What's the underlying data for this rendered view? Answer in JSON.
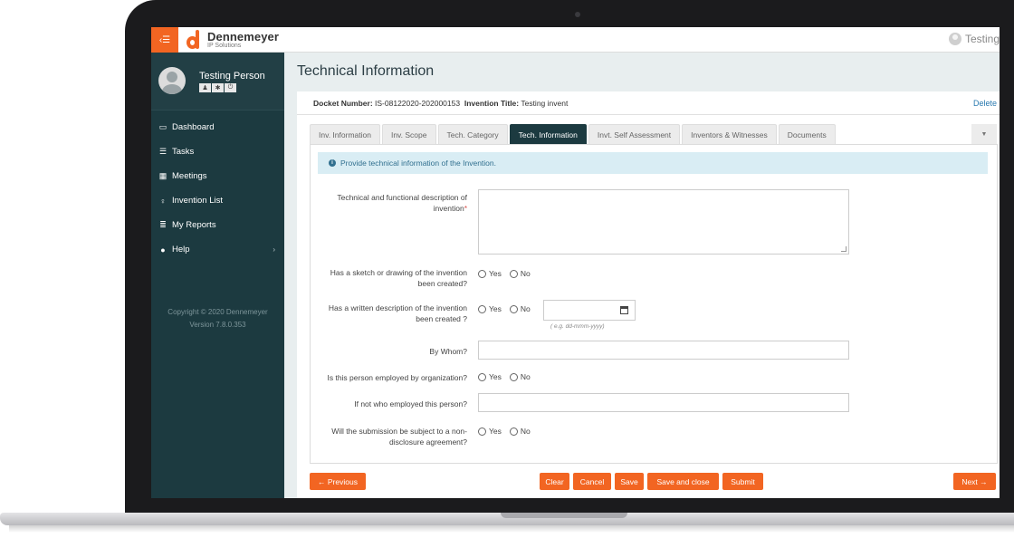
{
  "header": {
    "brand_name": "Dennemeyer",
    "brand_sub": "IP Solutions",
    "user_label": "Testing"
  },
  "sidebar": {
    "profile_name": "Testing Person",
    "items": [
      {
        "label": "Dashboard",
        "icon": "monitor-icon"
      },
      {
        "label": "Tasks",
        "icon": "list-icon"
      },
      {
        "label": "Meetings",
        "icon": "calendar-icon"
      },
      {
        "label": "Invention List",
        "icon": "lightbulb-icon"
      },
      {
        "label": "My Reports",
        "icon": "report-icon"
      },
      {
        "label": "Help",
        "icon": "question-icon"
      }
    ],
    "copyright": "Copyright © 2020 Dennemeyer",
    "version": "Version 7.8.0.353"
  },
  "page": {
    "title": "Technical Information",
    "docket_label": "Docket Number:",
    "docket_value": "IS-08122020-202000153",
    "invention_title_label": "Invention Title:",
    "invention_title_value": "Testing invent",
    "delete_label": "Delete"
  },
  "tabs": [
    {
      "label": "Inv. Information",
      "active": false
    },
    {
      "label": "Inv. Scope",
      "active": false
    },
    {
      "label": "Tech. Category",
      "active": false
    },
    {
      "label": "Tech. Information",
      "active": true
    },
    {
      "label": "Invt. Self Assessment",
      "active": false
    },
    {
      "label": "Inventors & Witnesses",
      "active": false
    },
    {
      "label": "Documents",
      "active": false
    }
  ],
  "form": {
    "info_text": "Provide technical information of the Invention.",
    "description_label_line1": "Technical and functional description of",
    "description_label_line2": "invention",
    "required_mark": "*",
    "description_value": "",
    "sketch_label_line1": "Has a sketch or drawing of the invention",
    "sketch_label_line2": "been created?",
    "written_label_line1": "Has a written description of the invention",
    "written_label_line2": "been created ?",
    "date_value": "",
    "date_hint": "( e.g. dd-mmm-yyyy)",
    "by_whom_label": "By Whom?",
    "by_whom_value": "",
    "employed_label": "Is this person employed by organization?",
    "not_employed_label": "If not who employed this person?",
    "not_employed_value": "",
    "nda_label_line1": "Will the submission be subject to a non-",
    "nda_label_line2": "disclosure agreement?",
    "yes_label": "Yes",
    "no_label": "No"
  },
  "buttons": {
    "previous": "Previous",
    "clear": "Clear",
    "cancel": "Cancel",
    "save": "Save",
    "save_close": "Save and close",
    "submit": "Submit",
    "next": "Next"
  },
  "colors": {
    "accent": "#f26522",
    "sidebar": "#1c3a40",
    "info_bg": "#d9edf4"
  }
}
